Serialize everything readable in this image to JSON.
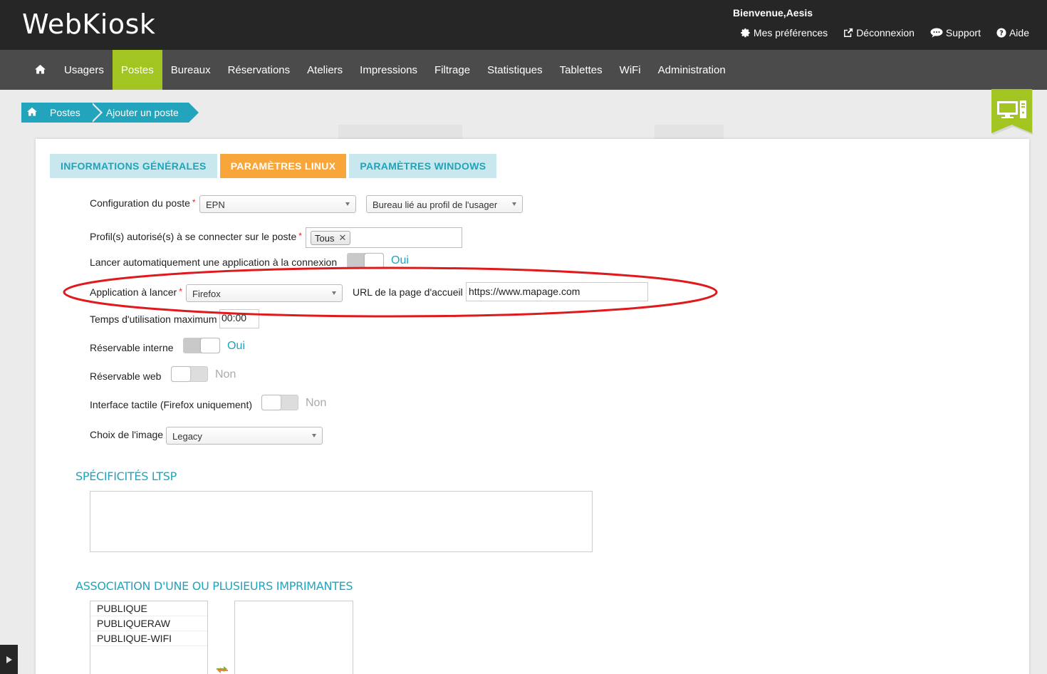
{
  "header": {
    "logo": "WebKiosk",
    "welcome": "Bienvenue,Aesis",
    "links": [
      {
        "label": "Mes préférences",
        "icon": "gear-icon"
      },
      {
        "label": "Déconnexion",
        "icon": "external-link-icon"
      },
      {
        "label": "Support",
        "icon": "chat-icon"
      },
      {
        "label": "Aide",
        "icon": "help-icon"
      }
    ]
  },
  "nav": {
    "items": [
      "Usagers",
      "Postes",
      "Bureaux",
      "Réservations",
      "Ateliers",
      "Impressions",
      "Filtrage",
      "Statistiques",
      "Tablettes",
      "WiFi",
      "Administration"
    ],
    "active": "Postes",
    "active_color": "#a2c521"
  },
  "breadcrumb": {
    "items": [
      "Postes",
      "Ajouter un poste"
    ],
    "color": "#22a4bc"
  },
  "tabs": {
    "info": "INFORMATIONS GÉNÉRALES",
    "linux": "PARAMÈTRES LINUX",
    "windows": "PARAMÈTRES WINDOWS",
    "active": "PARAMÈTRES LINUX"
  },
  "form": {
    "config_label": "Configuration du poste",
    "config_value": "EPN",
    "desktop_value": "Bureau lié au profil de l'usager",
    "profiles_label": "Profil(s) autorisé(s) à se connecter sur le poste",
    "profiles_tag": "Tous",
    "autolaunch_label": "Lancer automatiquement une application à la connexion",
    "autolaunch_state": "Oui",
    "app_label": "Application à lancer",
    "app_value": "Firefox",
    "url_label": "URL de la page d'accueil",
    "url_value": "https://www.mapage.com",
    "maxtime_label": "Temps d'utilisation maximum",
    "maxtime_value": "00:00",
    "reserv_int_label": "Réservable interne",
    "reserv_int_state": "Oui",
    "reserv_web_label": "Réservable web",
    "reserv_web_state": "Non",
    "touch_label": "Interface tactile (Firefox uniquement)",
    "touch_state": "Non",
    "image_label": "Choix de l'image",
    "image_value": "Legacy",
    "required_mark": "*"
  },
  "sections": {
    "ltsp_title": "SPÉCIFICITÉS LTSP",
    "ltsp_value": "",
    "printers_title": "ASSOCIATION D'UNE OU PLUSIEURS IMPRIMANTES",
    "printers_available": [
      "PUBLIQUE",
      "PUBLIQUERAW",
      "PUBLIQUE-WIFI"
    ],
    "printers_selected": []
  },
  "annotation": {
    "ellipse_color": "#e0191d"
  }
}
